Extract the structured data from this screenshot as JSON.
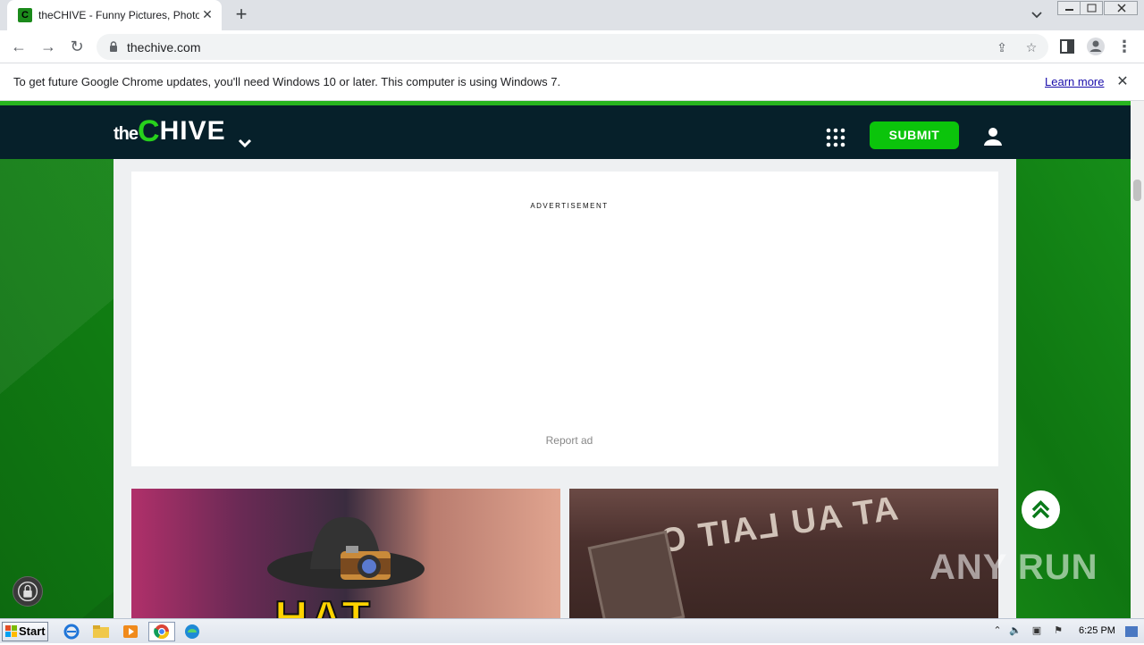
{
  "browser": {
    "tab_title": "theCHIVE - Funny Pictures, Photos, ",
    "tab_favicon_letter": "C",
    "url": "thechive.com",
    "infobar_message": "To get future Google Chrome updates, you'll need Windows 10 or later. This computer is using Windows 7.",
    "infobar_link": "Learn more"
  },
  "site": {
    "logo_the": "the",
    "logo_c": "C",
    "logo_hive": "HIVE",
    "submit_label": "SUBMIT",
    "ad_label": "ADVERTISEMENT",
    "report_ad": "Report ad",
    "thumb1_text": "HAT",
    "thumb2_text": "AT AU LAIT C",
    "watermark": "ANY RUN"
  },
  "taskbar": {
    "start_label": "Start",
    "clock": "6:25 PM"
  },
  "colors": {
    "header_bg": "#06202a",
    "brand_green": "#27d11c",
    "submit_green": "#0bc40b"
  }
}
